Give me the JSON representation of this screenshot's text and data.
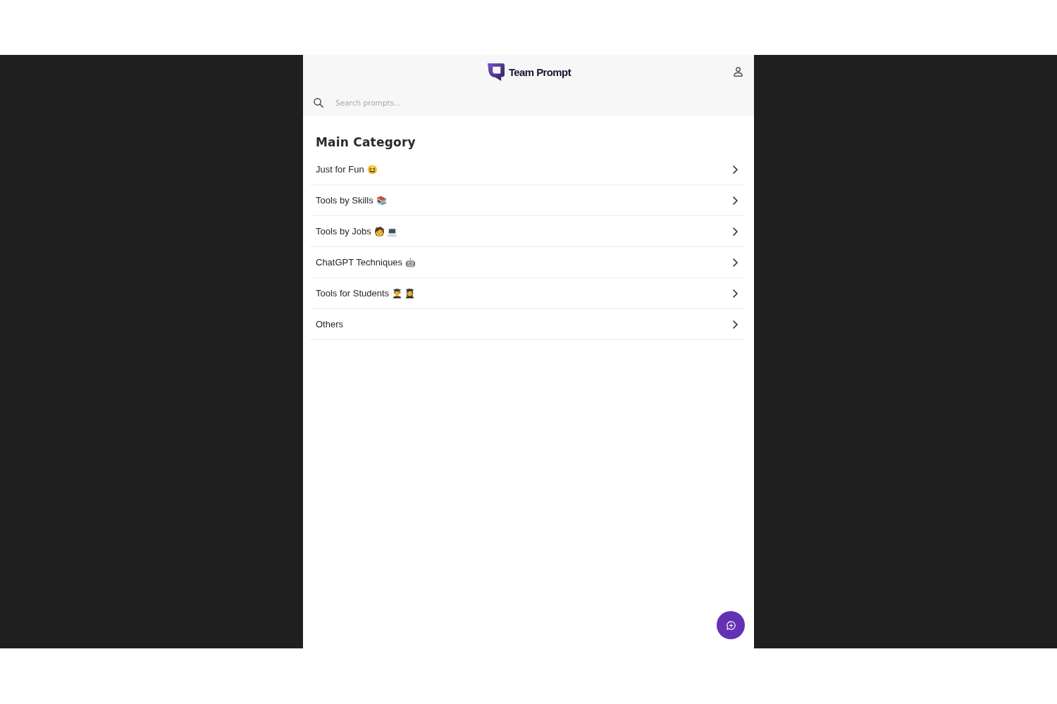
{
  "header": {
    "logo_text": "Team Prompt"
  },
  "search": {
    "placeholder": "Search prompts..."
  },
  "section": {
    "title": "Main Category"
  },
  "categories": [
    {
      "label": "Just for Fun",
      "emojis": [
        "😆"
      ]
    },
    {
      "label": "Tools by Skills",
      "emojis": [
        "📚"
      ]
    },
    {
      "label": "Tools by Jobs",
      "emojis": [
        "🧑",
        "💻"
      ]
    },
    {
      "label": "ChatGPT Techniques",
      "emojis": [
        "🤖"
      ]
    },
    {
      "label": "Tools for Students",
      "emojis": [
        "👨‍🎓",
        "👩‍🎓"
      ]
    },
    {
      "label": "Others"
    }
  ]
}
